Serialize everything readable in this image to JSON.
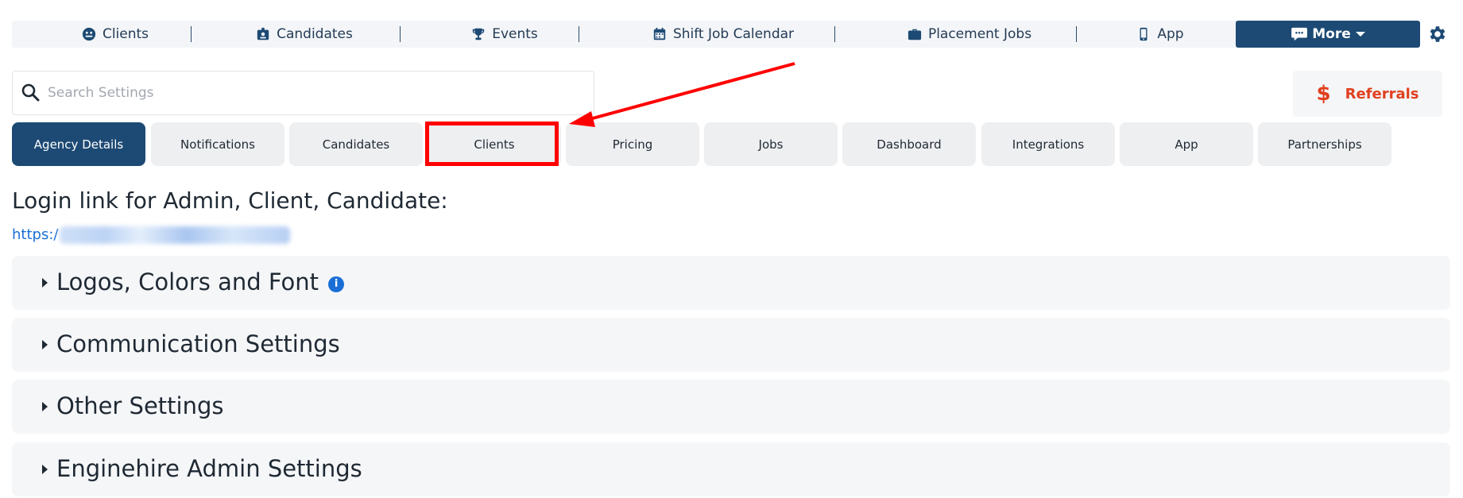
{
  "topnav": {
    "items": [
      {
        "label": "Clients",
        "icon": "clients-icon"
      },
      {
        "label": "Candidates",
        "icon": "candidates-icon"
      },
      {
        "label": "Events",
        "icon": "trophy-icon"
      },
      {
        "label": "Shift Job Calendar",
        "icon": "calendar-icon"
      },
      {
        "label": "Placement Jobs",
        "icon": "briefcase-icon"
      },
      {
        "label": "App",
        "icon": "phone-icon"
      }
    ],
    "more_label": "More",
    "more_icon": "chat-icon",
    "settings_icon": "gear-icon"
  },
  "search": {
    "placeholder": "Search Settings",
    "value": ""
  },
  "referrals": {
    "label": "Referrals",
    "symbol": "$"
  },
  "tabs": [
    {
      "label": "Agency Details",
      "active": true
    },
    {
      "label": "Notifications",
      "active": false
    },
    {
      "label": "Candidates",
      "active": false
    },
    {
      "label": "Clients",
      "active": false,
      "highlighted": true
    },
    {
      "label": "Pricing",
      "active": false
    },
    {
      "label": "Jobs",
      "active": false
    },
    {
      "label": "Dashboard",
      "active": false
    },
    {
      "label": "Integrations",
      "active": false
    },
    {
      "label": "App",
      "active": false
    },
    {
      "label": "Partnerships",
      "active": false
    }
  ],
  "login": {
    "title": "Login link for Admin, Client, Candidate:",
    "link_prefix": "https:/"
  },
  "sections": [
    {
      "label": "Logos, Colors and Font",
      "info": true
    },
    {
      "label": "Communication Settings",
      "info": false
    },
    {
      "label": "Other Settings",
      "info": false
    },
    {
      "label": "Enginehire Admin Settings",
      "info": false
    }
  ],
  "colors": {
    "primary": "#1d4a74",
    "referrals": "#e0401f",
    "link": "#1a6fd6",
    "annotation": "#ff0000"
  }
}
